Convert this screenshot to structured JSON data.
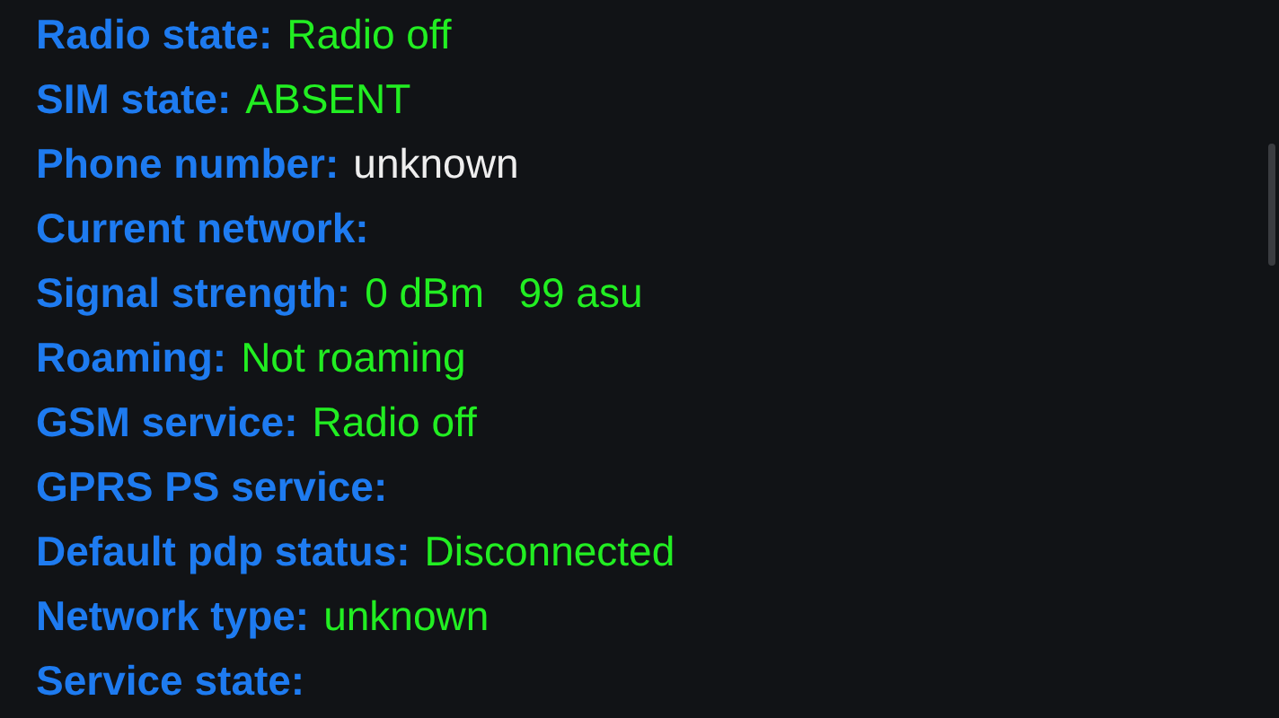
{
  "rows": [
    {
      "label": "Radio state:",
      "value": "Radio off",
      "color": "#22ee22"
    },
    {
      "label": "SIM state:",
      "value": "ABSENT",
      "color": "#22ee22"
    },
    {
      "label": "Phone number:",
      "value": "unknown",
      "color": "#eeeeee"
    },
    {
      "label": "Current network:"
    },
    {
      "label": "Signal strength:",
      "value": "0 dBm   99 asu",
      "color": "#22ee22"
    },
    {
      "label": "Roaming:",
      "value": "Not roaming",
      "color": "#22ee22"
    },
    {
      "label": "GSM service:",
      "value": "Radio off",
      "color": "#22ee22"
    },
    {
      "label": "GPRS PS service:"
    },
    {
      "label": "Default pdp status:",
      "value": "Disconnected",
      "color": "#22ee22"
    },
    {
      "label": "Network type:",
      "value": "unknown",
      "color": "#22ee22"
    },
    {
      "label": "Service state:"
    }
  ]
}
